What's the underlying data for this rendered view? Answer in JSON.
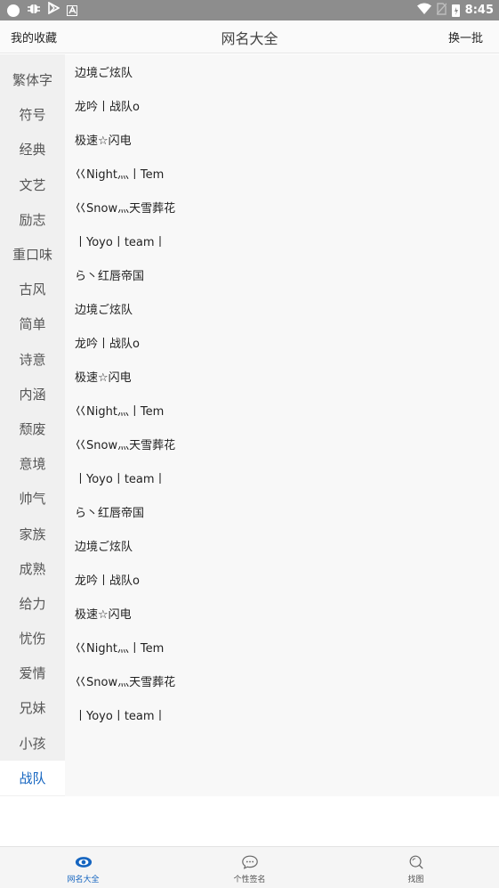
{
  "status_bar": {
    "time": "8:45",
    "left_icons": [
      "circle-icon",
      "bug-icon",
      "play-store-icon",
      "a-box-icon"
    ],
    "right_icons": [
      "wifi-icon",
      "no-sim-icon",
      "battery-icon"
    ]
  },
  "header": {
    "left_label": "我的收藏",
    "title": "网名大全",
    "right_label": "换一批"
  },
  "sidebar": {
    "active_index": 20,
    "items": [
      {
        "label": "繁体字"
      },
      {
        "label": "符号"
      },
      {
        "label": "经典"
      },
      {
        "label": "文艺"
      },
      {
        "label": "励志"
      },
      {
        "label": "重口味"
      },
      {
        "label": "古风"
      },
      {
        "label": "简单"
      },
      {
        "label": "诗意"
      },
      {
        "label": "内涵"
      },
      {
        "label": "颓废"
      },
      {
        "label": "意境"
      },
      {
        "label": "帅气"
      },
      {
        "label": "家族"
      },
      {
        "label": "成熟"
      },
      {
        "label": "给力"
      },
      {
        "label": "忧伤"
      },
      {
        "label": "爱情"
      },
      {
        "label": "兄妹"
      },
      {
        "label": "小孩"
      },
      {
        "label": "战队"
      }
    ]
  },
  "names": [
    {
      "text": "边境ご炫队"
    },
    {
      "text": "龙吟丨战队o"
    },
    {
      "text": "极速☆闪电"
    },
    {
      "text": "巜Night灬丨Tem"
    },
    {
      "text": "巜Snow灬天雪葬花"
    },
    {
      "text": "丨Yoyo丨team丨"
    },
    {
      "text": "ら丶红唇帝国"
    },
    {
      "text": "边境ご炫队"
    },
    {
      "text": "龙吟丨战队o"
    },
    {
      "text": "极速☆闪电"
    },
    {
      "text": "巜Night灬丨Tem"
    },
    {
      "text": "巜Snow灬天雪葬花"
    },
    {
      "text": "丨Yoyo丨team丨"
    },
    {
      "text": "ら丶红唇帝国"
    },
    {
      "text": "边境ご炫队"
    },
    {
      "text": "龙吟丨战队o"
    },
    {
      "text": "极速☆闪电"
    },
    {
      "text": "巜Night灬丨Tem"
    },
    {
      "text": "巜Snow灬天雪葬花"
    },
    {
      "text": "丨Yoyo丨team丨"
    }
  ],
  "tabbar": {
    "active_index": 0,
    "tabs": [
      {
        "label": "网名大全",
        "icon": "eye-icon"
      },
      {
        "label": "个性签名",
        "icon": "chat-bubble-icon"
      },
      {
        "label": "找图",
        "icon": "magnifier-icon"
      }
    ]
  },
  "colors": {
    "accent": "#1565c0",
    "status_bar": "#8d8d8d",
    "sidebar_bg": "#f0f0f0",
    "content_bg": "#f8f8f8"
  }
}
